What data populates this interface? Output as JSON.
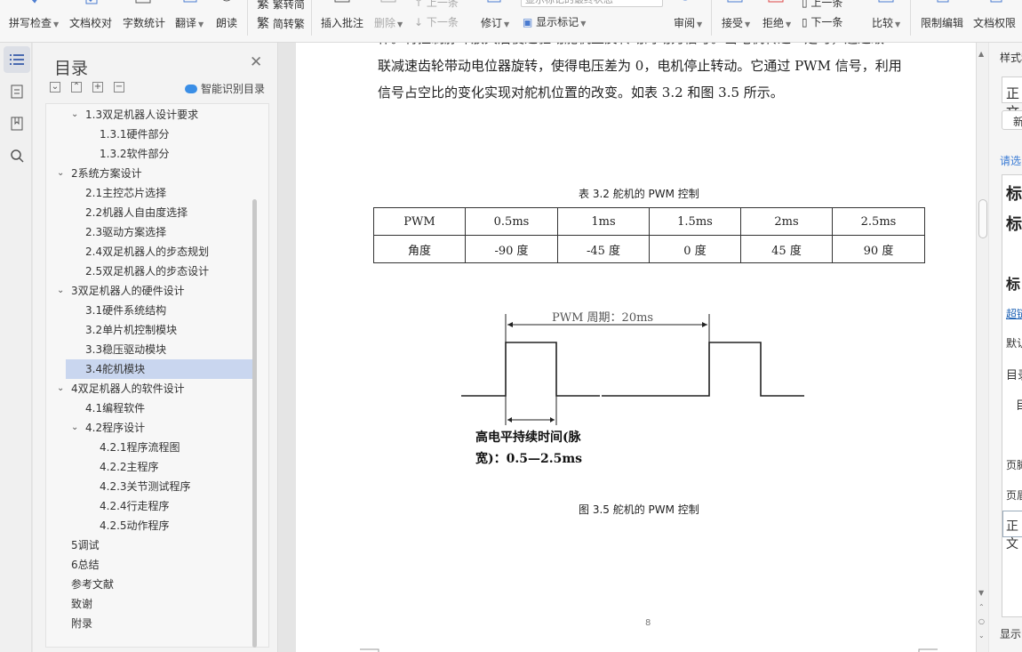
{
  "ribbon": {
    "spellcheck": "拼写检查",
    "proofread": "文档校对",
    "wordcount": "字数统计",
    "translate": "翻译",
    "read_aloud": "朗读",
    "simp_to_trad": "繁转简",
    "trad_to_simp": "简转繁",
    "insert_comment": "插入批注",
    "delete": "删除",
    "prev_comment": "上一条",
    "next_comment": "下一条",
    "track_changes": "修订",
    "display_state": "显示标记的最终状态",
    "show_markup": "显示标记",
    "review": "审阅",
    "accept": "接受",
    "reject": "拒绝",
    "prev_change": "上一条",
    "next_change": "下一条",
    "compare": "比较",
    "restrict_editing": "限制编辑",
    "doc_permissions": "文档权限"
  },
  "toc": {
    "title": "目录",
    "smart_detect": "智能识别目录",
    "items": [
      {
        "label": "1.3双足机器人设计要求",
        "level": 1,
        "arrow": "expanded"
      },
      {
        "label": "1.3.1硬件部分",
        "level": 2
      },
      {
        "label": "1.3.2软件部分",
        "level": 2
      },
      {
        "label": "2系统方案设计",
        "level": 0,
        "arrow": "expanded"
      },
      {
        "label": "2.1主控芯片选择",
        "level": 1
      },
      {
        "label": "2.2机器人自由度选择",
        "level": 1
      },
      {
        "label": "2.3驱动方案选择",
        "level": 1
      },
      {
        "label": "2.4双足机器人的步态规划",
        "level": 1
      },
      {
        "label": "2.5双足机器人的步态设计",
        "level": 1
      },
      {
        "label": "3双足机器人的硬件设计",
        "level": 0,
        "arrow": "expanded"
      },
      {
        "label": "3.1硬件系统结构",
        "level": 1
      },
      {
        "label": "3.2单片机控制模块",
        "level": 1
      },
      {
        "label": "3.3稳压驱动模块",
        "level": 1
      },
      {
        "label": "3.4舵机模块",
        "level": 1,
        "selected": true
      },
      {
        "label": "4双足机器人的软件设计",
        "level": 0,
        "arrow": "expanded"
      },
      {
        "label": "4.1编程软件",
        "level": 1
      },
      {
        "label": "4.2程序设计",
        "level": 1,
        "arrow": "expanded"
      },
      {
        "label": "4.2.1程序流程图",
        "level": 2
      },
      {
        "label": "4.2.2主程序",
        "level": 2
      },
      {
        "label": "4.2.3关节测试程序",
        "level": 2
      },
      {
        "label": "4.2.4行走程序",
        "level": 2
      },
      {
        "label": "4.2.5动作程序",
        "level": 2
      },
      {
        "label": "5调试",
        "level": 0
      },
      {
        "label": "6总结",
        "level": 0
      },
      {
        "label": "参考文献",
        "level": 0
      },
      {
        "label": "致谢",
        "level": 0
      },
      {
        "label": "附录",
        "level": 0
      }
    ]
  },
  "doc": {
    "line_top": "作。将控制脉冲放大后使之驱动舵机正反转动的动力信号。当电机转过一定时，通过级",
    "line1": "联减速齿轮带动电位器旋转，使得电压差为 0，电机停止转动。它通过 PWM 信号，利用",
    "line2": "信号占空比的变化实现对舵机位置的改变。如表 3.2 和图 3.5 所示。",
    "table_caption": "表 3.2 舵机的 PWM 控制",
    "table": {
      "header": [
        "PWM",
        "0.5ms",
        "1ms",
        "1.5ms",
        "2ms",
        "2.5ms"
      ],
      "row": [
        "角度",
        "-90 度",
        "-45 度",
        "0 度",
        "45 度",
        "90 度"
      ]
    },
    "figure": {
      "period_label": "PWM 周期：20ms",
      "pulse_label_1": "高电平持续时间(脉",
      "pulse_label_2": "宽)：0.5—2.5ms"
    },
    "figure_caption": "图 3.5 舵机的 PWM 控制",
    "page_number": "8"
  },
  "right_panel": {
    "style_label": "样式和",
    "normal": "正文",
    "new_label": "新",
    "please_select": "请选",
    "heading_a": "标",
    "heading_b": "标",
    "heading_c": "标",
    "hyperlink": "超链",
    "default": "默认",
    "toc_label": "目录",
    "toc_sub": "目",
    "footer": "页脚",
    "header": "页眉",
    "normal2": "正文",
    "show": "显示"
  },
  "colors": {
    "selection": "#c9d6ef",
    "accent_blue": "#3a8ee6",
    "link_blue": "#1a5fb4"
  }
}
